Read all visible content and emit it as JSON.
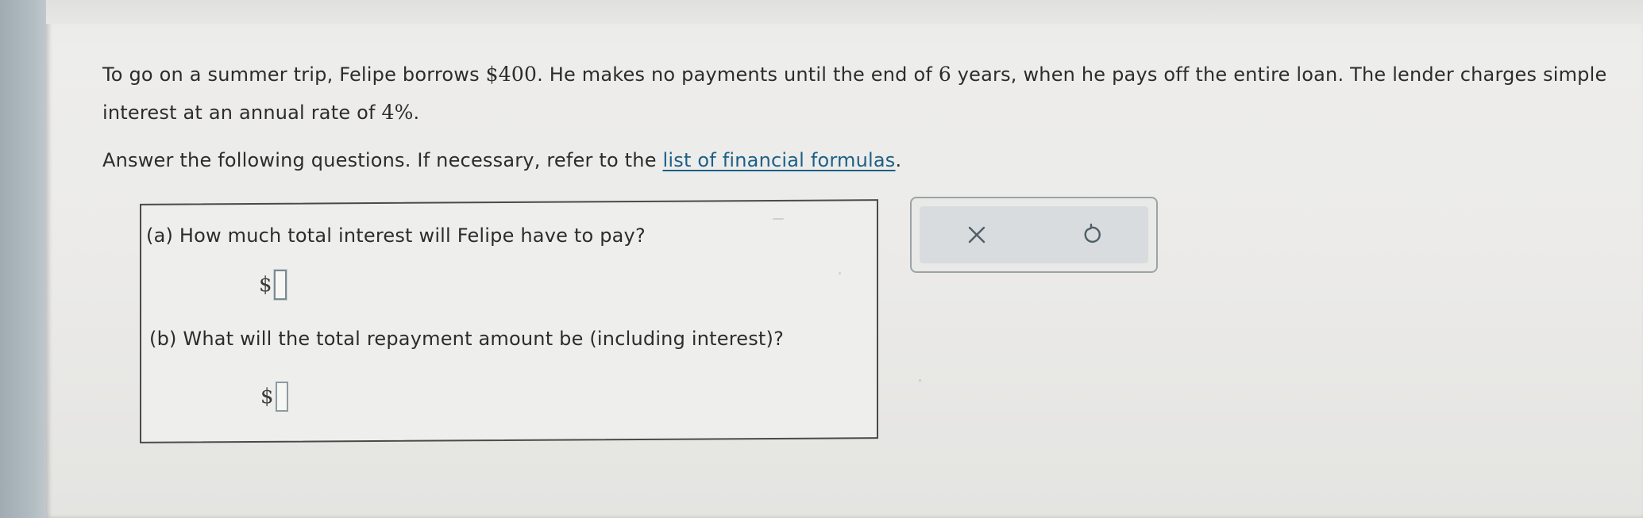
{
  "problem": {
    "part1": "To go on a summer trip, Felipe borrows ",
    "amount": "$400",
    "part2": ". He makes no payments until the end of ",
    "years": "6",
    "part3": " years, when he pays off the entire loan. The lender charges simple interest at an annual rate of ",
    "rate": "4%",
    "part4": "."
  },
  "instructions": {
    "text": "Answer the following questions. If necessary, refer to the ",
    "link_label": "list of financial formulas",
    "end": "."
  },
  "questions": [
    {
      "label": "(a) How much total interest will Felipe have to pay?",
      "currency": "$",
      "value": ""
    },
    {
      "label": "(b) What will the total repayment amount be (including interest)?",
      "currency": "$",
      "value": ""
    }
  ],
  "toolbar": {
    "clear_icon": "close-icon",
    "undo_icon": "undo-icon",
    "accent": "#5a6a74"
  }
}
